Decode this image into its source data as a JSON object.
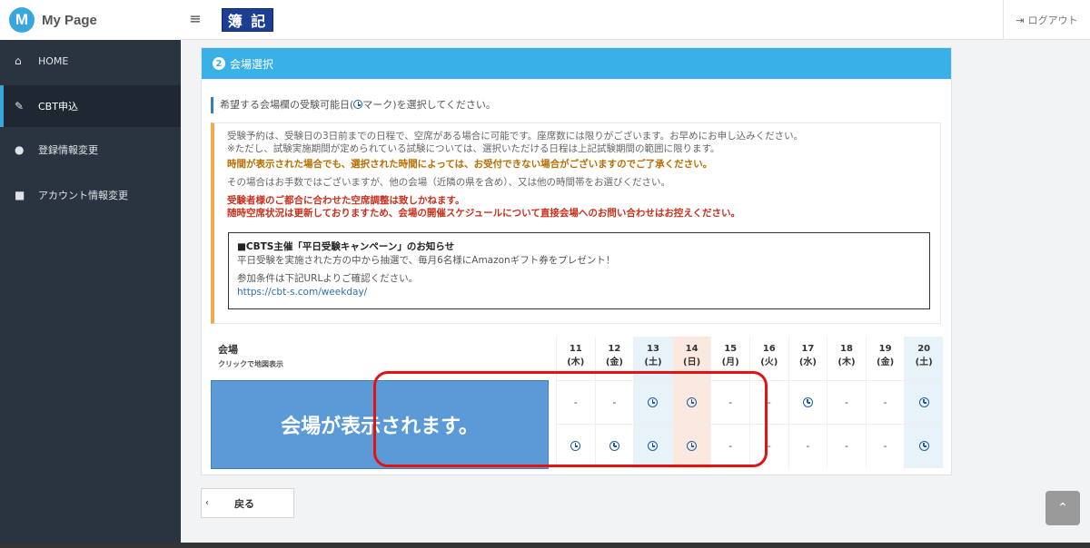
{
  "header": {
    "brand_letter": "M",
    "brand_name": "My Page",
    "menu_icon": "hamburger-icon",
    "exam_badge": "簿 記",
    "logout_label": "ログアウト",
    "logout_icon": "sign-out-icon"
  },
  "sidebar": {
    "items": [
      {
        "label": "HOME",
        "icon": "home-icon"
      },
      {
        "label": "CBT申込",
        "icon": "pencil-icon",
        "active": true
      },
      {
        "label": "登録情報変更",
        "icon": "user-icon"
      },
      {
        "label": "アカウント情報変更",
        "icon": "lock-icon"
      }
    ]
  },
  "panel": {
    "step": "2",
    "title": "会場選択",
    "lead_before": "希望する会場欄の受験可能日(",
    "lead_after": "マーク)を選択してください。",
    "notice": {
      "line1": "受験予約は、受験日の3日前までの日程で、空席がある場合に可能です。座席数には限りがございます。お早めにお申し込みください。",
      "line2": "※ただし、試験実施期間が定められている試験については、選択いただける日程は上記試験期間の範囲に限ります。",
      "line3": "時間が表示された場合でも、選択された時間によっては、お受付できない場合がございますのでご了承ください。",
      "line4": "その場合はお手数ではございますが、他の会場（近隣の県を含め）、又は他の時間帯をお選びください。",
      "line5": "受験者様のご都合に合わせた空席調整は致しかねます。",
      "line6": "随時空席状況は更新しておりますため、会場の開催スケジュールについて直接会場へのお問い合わせはお控えください。"
    },
    "campaign": {
      "title": "■CBTS主催「平日受験キャンペーン」のお知らせ",
      "line1": "平日受験を実施された方の中から抽選で、毎月6名様にAmazonギフト券をプレゼント！",
      "line2": "参加条件は下記URLよりご確認ください。",
      "url": "https://cbt-s.com/weekday/"
    }
  },
  "schedule": {
    "venue_label": "会場",
    "venue_sub": "クリックで地図表示",
    "venue_placeholder": "会場が表示されます。",
    "days": [
      {
        "date": "11",
        "dow": "(木)",
        "row1": "-",
        "row2": "clock"
      },
      {
        "date": "12",
        "dow": "(金)",
        "row1": "-",
        "row2": "clock"
      },
      {
        "date": "13",
        "dow": "(土)",
        "row1": "clock",
        "row2": "clock",
        "weekend": "sat"
      },
      {
        "date": "14",
        "dow": "(日)",
        "row1": "clock",
        "row2": "clock",
        "weekend": "sun"
      },
      {
        "date": "15",
        "dow": "(月)",
        "row1": "-",
        "row2": "-"
      },
      {
        "date": "16",
        "dow": "(火)",
        "row1": "-",
        "row2": "-"
      },
      {
        "date": "17",
        "dow": "(水)",
        "row1": "clock",
        "row2": "-"
      },
      {
        "date": "18",
        "dow": "(木)",
        "row1": "-",
        "row2": "-"
      },
      {
        "date": "19",
        "dow": "(金)",
        "row1": "-",
        "row2": "-"
      },
      {
        "date": "20",
        "dow": "(土)",
        "row1": "clock",
        "row2": "clock",
        "weekend": "sat"
      }
    ]
  },
  "footer": {
    "back_label": "戻る",
    "back_icon": "chevron-left-icon",
    "totop_icon": "chevron-up-icon"
  },
  "colors": {
    "accent": "#3ab1e6",
    "sidebar": "#2a3440",
    "venue_box": "#5b9ad6",
    "highlight_ring": "#e31313"
  }
}
